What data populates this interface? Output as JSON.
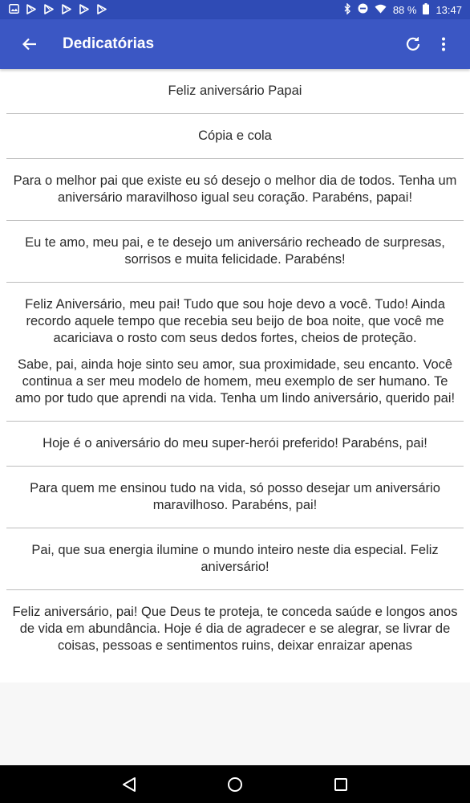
{
  "status_bar": {
    "battery": "88 %",
    "time": "13:47",
    "notification_icons": [
      "image-icon",
      "play-store-icon",
      "play-store-icon",
      "play-store-icon",
      "play-store-icon",
      "play-store-icon"
    ],
    "system_icons": [
      "bluetooth-icon",
      "do-not-disturb-icon",
      "wifi-icon",
      "battery-icon"
    ]
  },
  "app_bar": {
    "title": "Dedicatórias",
    "color": "#3b57c4"
  },
  "items": [
    {
      "paragraphs": [
        "Feliz aniversário Papai"
      ]
    },
    {
      "paragraphs": [
        "Cópia e cola"
      ]
    },
    {
      "paragraphs": [
        "Para o melhor pai que existe eu só desejo o melhor dia de todos. Tenha um aniversário maravilhoso igual seu coração. Parabéns, papai!"
      ]
    },
    {
      "paragraphs": [
        "Eu te amo, meu pai, e te desejo um aniversário recheado de surpresas, sorrisos e muita felicidade. Parabéns!"
      ]
    },
    {
      "paragraphs": [
        "Feliz Aniversário, meu pai! Tudo que sou hoje devo a você. Tudo! Ainda recordo aquele tempo que recebia seu beijo de boa noite, que você me acariciava o rosto com seus dedos fortes, cheios de proteção.",
        "Sabe, pai, ainda hoje sinto seu amor, sua proximidade, seu encanto. Você continua a ser meu modelo de homem, meu exemplo de ser humano. Te amo por tudo que aprendi na vida. Tenha um lindo aniversário, querido pai!"
      ]
    },
    {
      "paragraphs": [
        "Hoje é o aniversário do meu super-herói preferido! Parabéns, pai!"
      ]
    },
    {
      "paragraphs": [
        "Para quem me ensinou tudo na vida, só posso desejar um aniversário maravilhoso. Parabéns, pai!"
      ]
    },
    {
      "paragraphs": [
        "Pai, que sua energia ilumine o mundo inteiro neste dia especial. Feliz aniversário!"
      ]
    },
    {
      "paragraphs": [
        "Feliz aniversário, pai! Que Deus te proteja, te conceda saúde e longos anos de vida em abundância. Hoje é dia de agradecer e se alegrar, se livrar de coisas, pessoas e sentimentos ruins, deixar enraizar apenas"
      ]
    }
  ]
}
